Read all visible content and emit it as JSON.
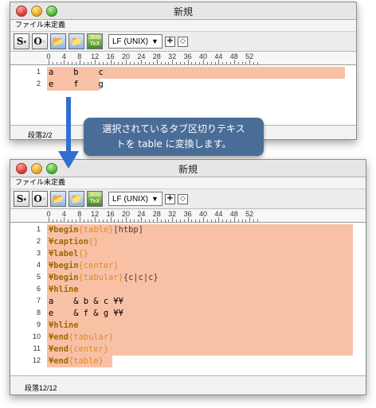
{
  "top_window": {
    "title": "新規",
    "menu_label": "ファイル未定義",
    "linefeed_select": "LF (UNIX)",
    "ruler_labels": [
      "0",
      "4",
      "8",
      "12",
      "16",
      "20",
      "24",
      "28",
      "32",
      "36",
      "40",
      "44",
      "48",
      "52"
    ],
    "line_numbers": [
      "1",
      "2"
    ],
    "lines": [
      "a    b    c",
      "e    f    g"
    ],
    "status": "段落2/2"
  },
  "callout": {
    "line1": "選択されているタブ区切りテキス",
    "line2": "トを table に変換します。"
  },
  "bottom_window": {
    "title": "新規",
    "menu_label": "ファイル未定義",
    "linefeed_select": "LF (UNIX)",
    "ruler_labels": [
      "0",
      "4",
      "8",
      "12",
      "16",
      "20",
      "24",
      "28",
      "32",
      "36",
      "40",
      "44",
      "48",
      "52"
    ],
    "line_numbers": [
      "1",
      "2",
      "3",
      "4",
      "5",
      "6",
      "7",
      "8",
      "9",
      "10",
      "11",
      "12"
    ],
    "status": "段落12/12",
    "code": {
      "l1a": "¥begin",
      "l1b": "{table}",
      "l1c": "[htbp]",
      "l2a": "¥caption",
      "l2b": "{}",
      "l3a": "¥label",
      "l3b": "{}",
      "l4a": "¥begin",
      "l4b": "{center}",
      "l5a": "¥begin",
      "l5b": "{tabular}",
      "l5c": "{c|c|c}",
      "l6a": "¥hline",
      "l7": "a    & b & c ¥¥",
      "l8": "e    & f & g ¥¥",
      "l9a": "¥hline",
      "l10a": "¥end",
      "l10b": "{tabular}",
      "l11a": "¥end",
      "l11b": "{center}",
      "l12a": "¥end",
      "l12b": "{table}"
    }
  },
  "colors": {
    "selection": "#f8c1a6",
    "callout_bg": "#4a6d97",
    "arrow": "#2f6fd0"
  },
  "icons": [
    "close-light",
    "minimize-light",
    "zoom-light",
    "section-icon",
    "outline-icon",
    "open-folder-icon",
    "save-folder-icon",
    "jbibtex-icon",
    "plus-icon",
    "diamond-icon"
  ],
  "toolbar": {
    "jbibtex_label": "JBib TeX",
    "section_label": "S",
    "outline_label": "O"
  }
}
